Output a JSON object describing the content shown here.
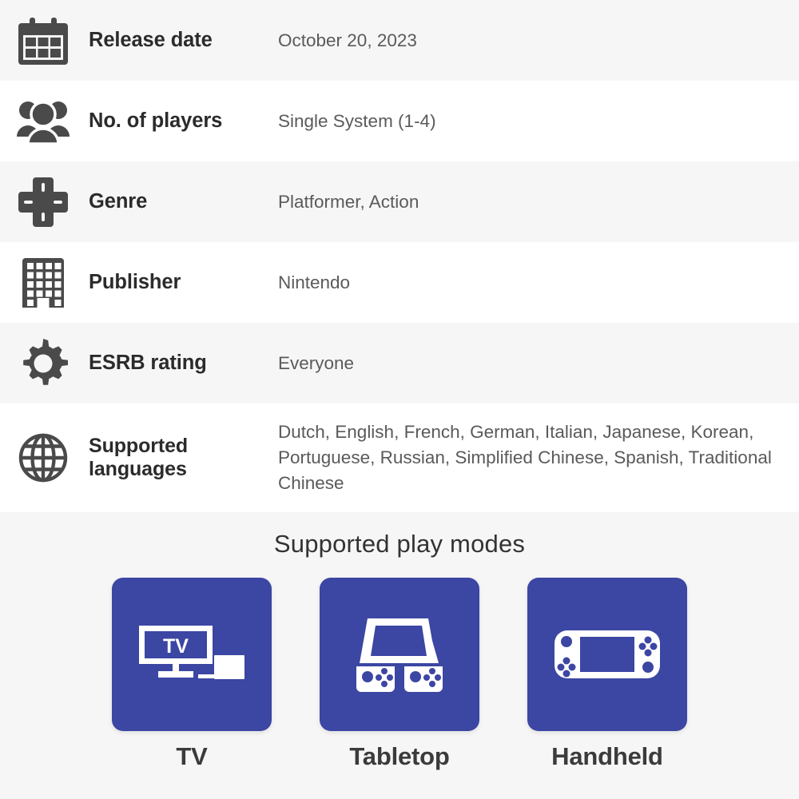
{
  "specs": {
    "rows": [
      {
        "icon": "calendar-icon",
        "label": "Release date",
        "value": "October 20, 2023",
        "shade": "alt"
      },
      {
        "icon": "players-group-icon",
        "label": "No. of players",
        "value": "Single System (1-4)",
        "shade": "plain"
      },
      {
        "icon": "dpad-icon",
        "label": "Genre",
        "value": "Platformer, Action",
        "shade": "alt"
      },
      {
        "icon": "building-icon",
        "label": "Publisher",
        "value": "Nintendo",
        "shade": "plain"
      },
      {
        "icon": "gear-icon",
        "label": "ESRB rating",
        "value": "Everyone",
        "shade": "alt"
      },
      {
        "icon": "globe-icon",
        "label": "Supported languages",
        "value": "Dutch, English, French, German, Italian, Japanese, Korean, Portuguese, Russian, Simplified Chinese, Spanish, Traditional Chinese",
        "shade": "plain"
      }
    ]
  },
  "play_modes": {
    "title": "Supported play modes",
    "items": [
      {
        "icon": "tv-screen-icon",
        "label": "TV",
        "screen_text": "TV"
      },
      {
        "icon": "tabletop-console-icon",
        "label": "Tabletop"
      },
      {
        "icon": "handheld-console-icon",
        "label": "Handheld"
      }
    ]
  },
  "colors": {
    "tile_blue": "#3c46a3",
    "row_alt_background": "#f6f6f6",
    "row_plain_background": "#ffffff",
    "label_text": "#2b2b2b",
    "value_text": "#5a5a5a",
    "icon_gray": "#4a4a4a"
  }
}
